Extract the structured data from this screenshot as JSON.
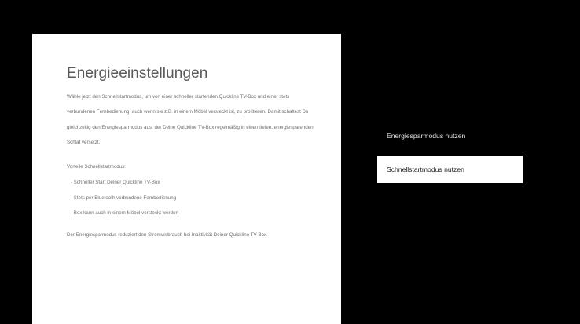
{
  "info_panel": {
    "title": "Energieeinstellungen",
    "description": "Wähle jetzt den Schnellstartmodus, um von einer schneller startenden Quickline TV-Box und einer stets verbundenen Fernbedienung, auch wenn sie z.B. in einem Möbel versteckt ist, zu profitieren. Damit schaltest Du gleichzeitig den Energiesparmodus aus, der Deine Quickline TV-Box regelmäßig in einen tiefen, energiesparenden Schlaf versetzt.",
    "advantages_title": "Vorteile Schnellstartmodus:",
    "advantages": [
      "- Schneller Start Deiner Quickline TV-Box",
      "- Stets per Bluetooth verbundene Fernbedienung",
      "- Box kann auch in einem Möbel versteckt werden"
    ],
    "footer": "Der Energiesparmodus reduziert den Stromverbrauch bei Inaktivität Deiner Quickline TV-Box."
  },
  "options": [
    {
      "label": "Energiesparmodus nutzen",
      "selected": false
    },
    {
      "label": "Schnellstartmodus nutzen",
      "selected": true
    }
  ],
  "colors": {
    "background": "#000000",
    "panel": "#ffffff",
    "selected_option_bg": "#ffffff",
    "selected_option_text": "#202020",
    "option_text": "#e6e6e6"
  }
}
